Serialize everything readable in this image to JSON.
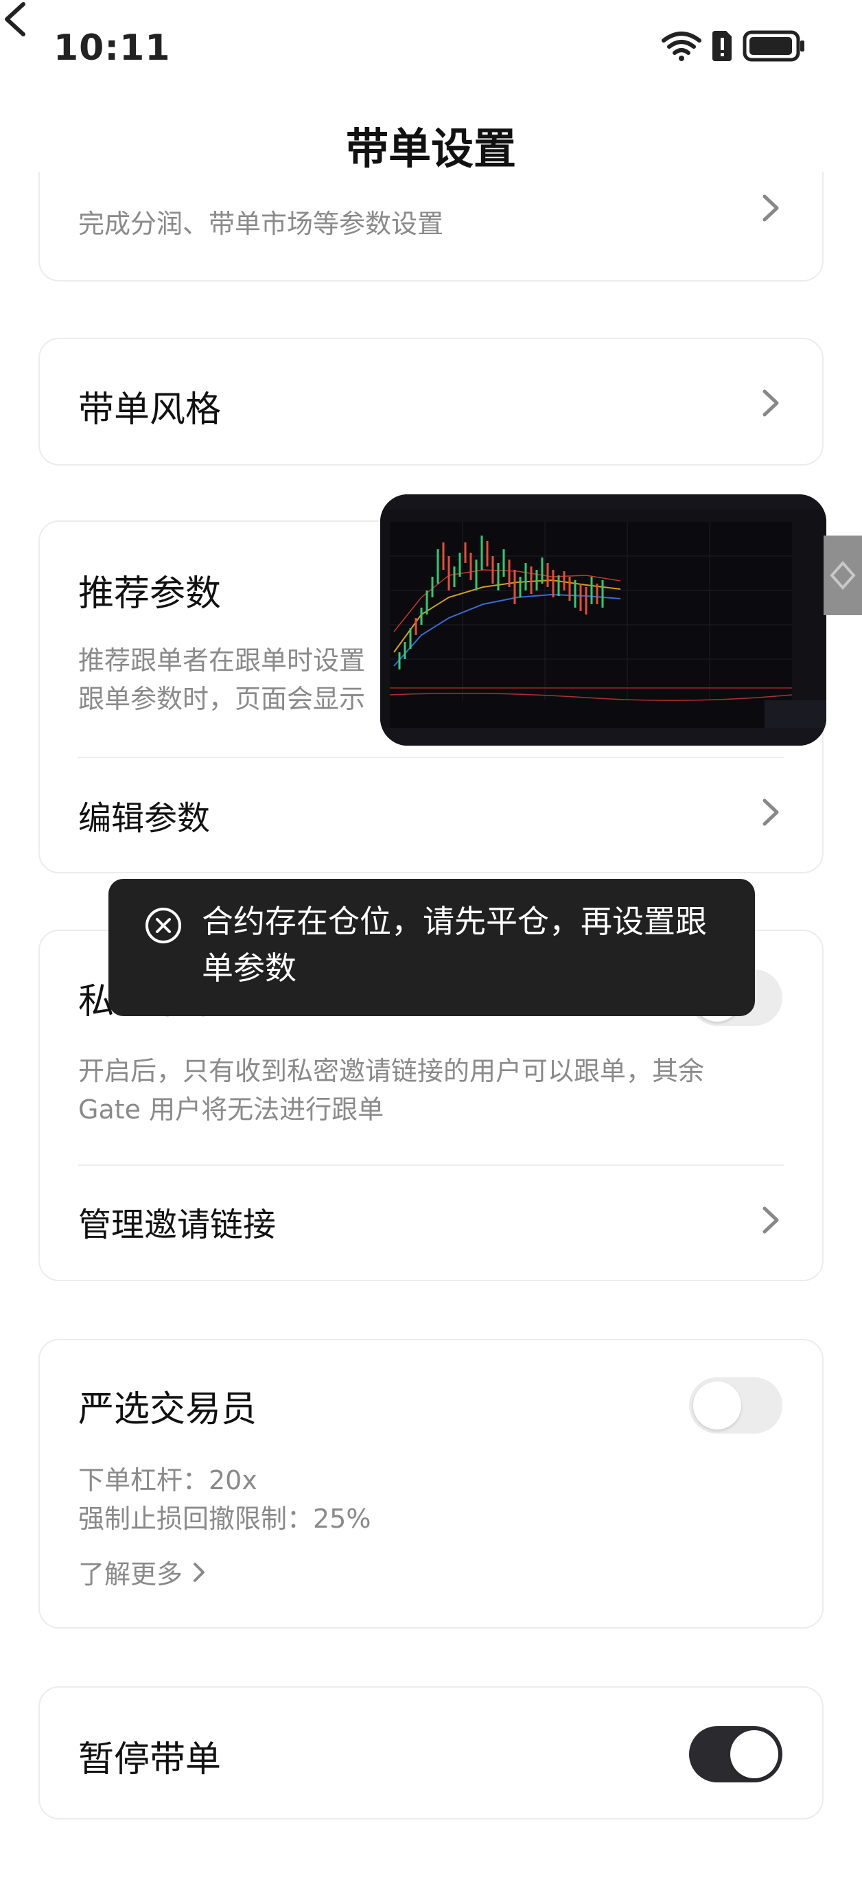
{
  "status_bar": {
    "time": "10:11"
  },
  "header": {
    "title": "带单设置"
  },
  "card_params": {
    "subtitle": "完成分润、带单市场等参数设置"
  },
  "card_style": {
    "title": "带单风格"
  },
  "card_recommend": {
    "title": "推荐参数",
    "desc_line1": "推荐跟单者在跟单时设置",
    "desc_line2": "跟单参数时，页面会显示",
    "edit_label": "编辑参数"
  },
  "toast": {
    "message": "合约存在仓位，请先平仓，再设置跟单参数"
  },
  "card_private": {
    "title": "私域带单",
    "desc_line1": "开启后，只有收到私密邀请链接的用户可以跟单，其余",
    "desc_line2": "Gate 用户将无法进行跟单",
    "manage_label": "管理邀请链接",
    "toggle_on": false
  },
  "card_select": {
    "title": "严选交易员",
    "leverage": "下单杠杆：20x",
    "stop_loss": "强制止损回撤限制：25%",
    "learn_more": "了解更多",
    "toggle_on": false
  },
  "card_pause": {
    "title": "暂停带单",
    "toggle_on": true
  },
  "colors": {
    "toggle_on": "#2b2b2f",
    "toggle_off": "#ececec",
    "toast_bg": "#212121"
  }
}
